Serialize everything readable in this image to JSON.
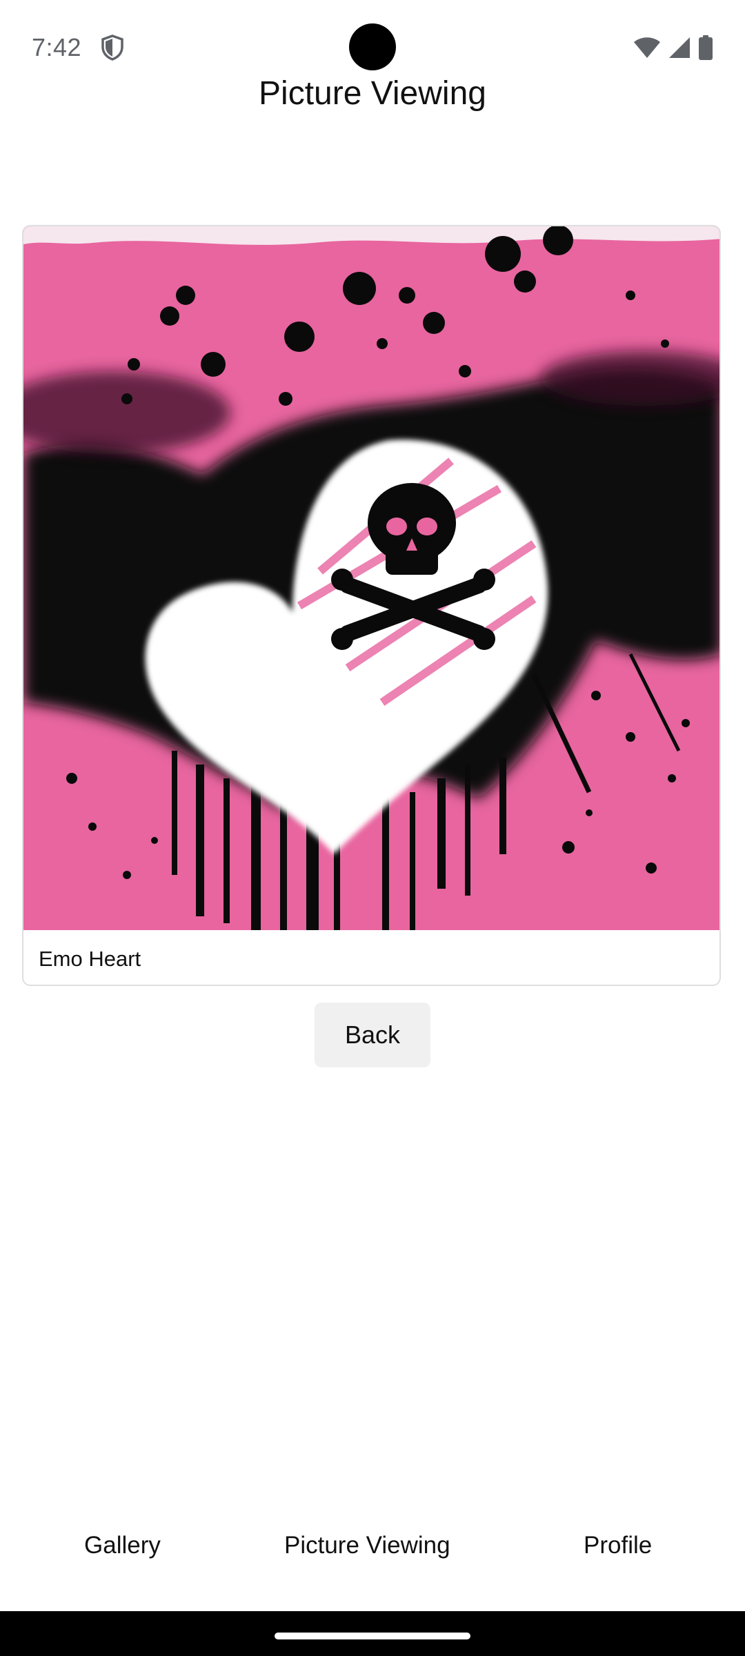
{
  "status_bar": {
    "time": "7:42",
    "shield_icon": "shield-icon",
    "wifi_icon": "wifi-icon",
    "signal_icon": "cellular-signal-icon",
    "battery_icon": "battery-icon"
  },
  "header": {
    "title": "Picture Viewing"
  },
  "picture": {
    "caption": "Emo Heart",
    "image_description_icon": "emo-heart-image"
  },
  "actions": {
    "back_label": "Back"
  },
  "bottom_nav": {
    "items": [
      {
        "label": "Gallery"
      },
      {
        "label": "Picture Viewing"
      },
      {
        "label": "Profile"
      }
    ]
  },
  "colors": {
    "pink": "#e8659f",
    "black": "#0a0a0a",
    "white": "#ffffff",
    "button_bg": "#f0f0f0"
  }
}
